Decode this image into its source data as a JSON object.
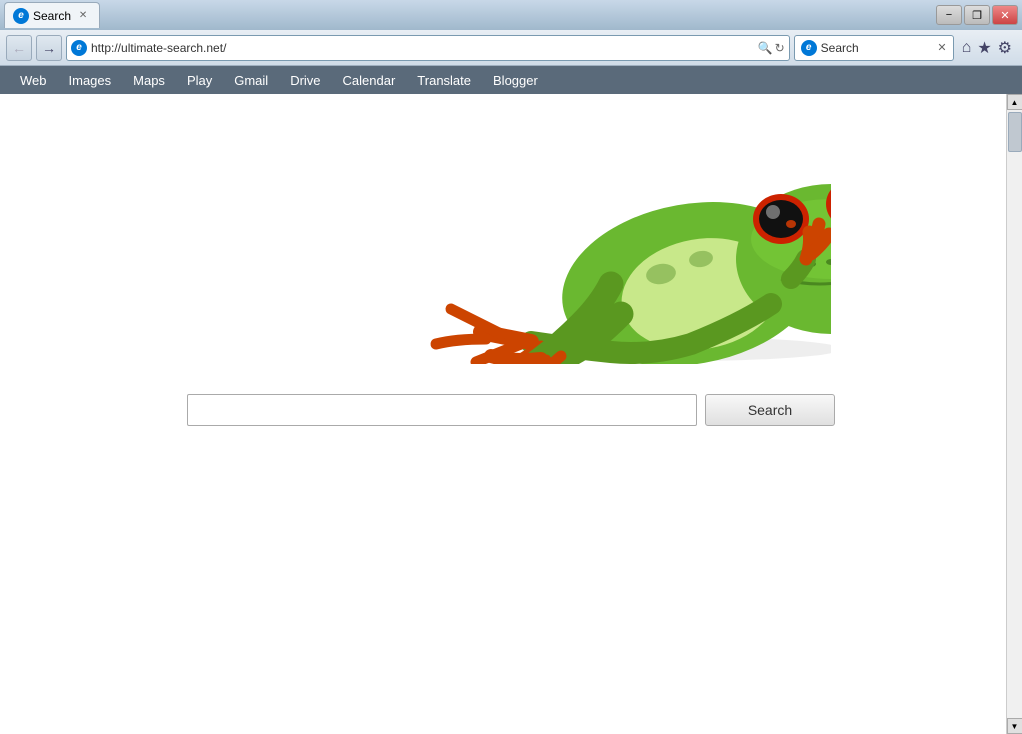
{
  "window": {
    "title": "Search",
    "url": "http://ultimate-search.net/"
  },
  "titlebar": {
    "tab_label": "Search",
    "minimize": "−",
    "restore": "❐",
    "close": "✕"
  },
  "addressbar": {
    "url": "http://ultimate-search.net/",
    "search_placeholder": "Search",
    "search_tab_label": "Search"
  },
  "navbar": {
    "items": [
      "Web",
      "Images",
      "Maps",
      "Play",
      "Gmail",
      "Drive",
      "Calendar",
      "Translate",
      "Blogger"
    ]
  },
  "searchbox": {
    "placeholder": "",
    "button_label": "Search"
  }
}
